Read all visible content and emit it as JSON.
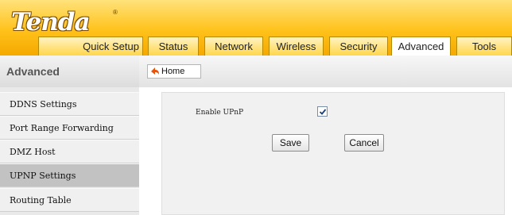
{
  "brand": {
    "logo_text": "Tenda",
    "logo_mark": "®"
  },
  "nav": {
    "tabs": [
      {
        "label": "Quick Setup"
      },
      {
        "label": "Status"
      },
      {
        "label": "Network"
      },
      {
        "label": "Wireless"
      },
      {
        "label": "Security"
      },
      {
        "label": "Advanced",
        "active": true
      },
      {
        "label": "Tools"
      }
    ]
  },
  "sidebar": {
    "title": "Advanced",
    "items": [
      {
        "label": "DDNS Settings"
      },
      {
        "label": "Port Range Forwarding"
      },
      {
        "label": "DMZ Host"
      },
      {
        "label": "UPNP Settings",
        "active": true
      },
      {
        "label": "Routing Table"
      }
    ]
  },
  "breadcrumb": {
    "home_label": "Home"
  },
  "form": {
    "enable_upnp_label": "Enable UPnP",
    "enable_upnp_checked": true,
    "save_label": "Save",
    "cancel_label": "Cancel"
  },
  "colors": {
    "header_top": "#ffe27a",
    "header_bottom": "#f5a800",
    "active_nav": "#c2c2c2"
  }
}
